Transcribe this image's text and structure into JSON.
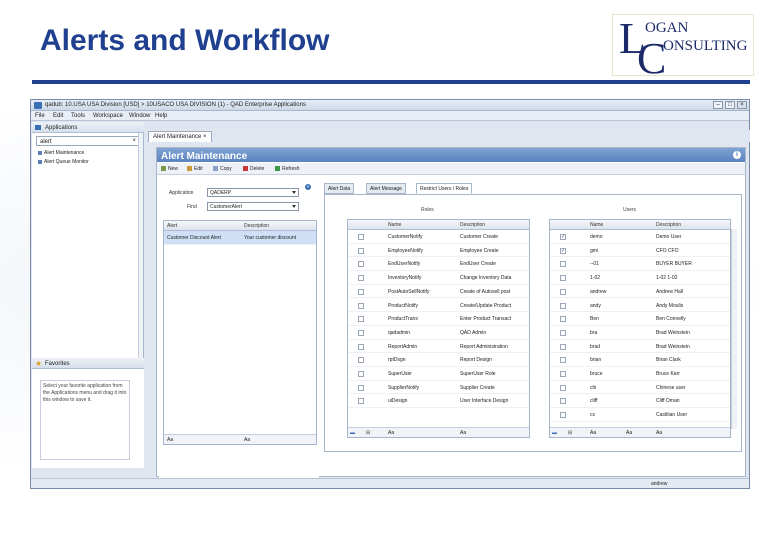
{
  "slide": {
    "title": "Alerts and Workflow"
  },
  "logo": {
    "big1": "L",
    "word1": "OGAN",
    "big2": "C",
    "word2": "ONSULTING"
  },
  "window": {
    "title": "qadub: 10.USA USA Division [USD] > 10USACO USA DIVISION (1) - QAD Enterprise Applications"
  },
  "menu": [
    "File",
    "Edit",
    "Tools",
    "Workspace",
    "Window",
    "Help"
  ],
  "left": {
    "header": "Applications",
    "search_value": "alert",
    "items": [
      "Alert Maintenance",
      "Alert Queue Monitor"
    ],
    "favorites_header": "Favorites",
    "favorites_text": "Select your favorite application from the Applications menu and drag it into this window to save it."
  },
  "tab": {
    "label": "Alert Maintenance"
  },
  "panel": {
    "title": "Alert Maintenance"
  },
  "toolbar": [
    "New",
    "Edit",
    "Copy",
    "Delete",
    "Refresh"
  ],
  "form": {
    "application_label": "Application",
    "application_value": "QADERP",
    "find_label": "Find",
    "find_value": "CustomerAlert",
    "grid_cols": [
      "Alert",
      "Description"
    ],
    "grid_rows": [
      [
        "Customer Discount Alert",
        "Your customer discount"
      ]
    ],
    "footer": [
      "Aa",
      "Aa"
    ]
  },
  "subtabs": [
    "Alert Data",
    "Alert Message",
    "Restrict Users / Roles"
  ],
  "roles": {
    "caption": "Roles",
    "cols": [
      "Name",
      "Description"
    ],
    "rows": [
      [
        "CustomerNotify",
        "Customer Create"
      ],
      [
        "EmployeeNotify",
        "Employee Create"
      ],
      [
        "EndUserNotify",
        "EndUser Create"
      ],
      [
        "InventoryNotify",
        "Change Inventory Data"
      ],
      [
        "PostAutoSellNotify",
        "Create of Autosell post"
      ],
      [
        "ProductNotify",
        "Create/Update Product"
      ],
      [
        "ProductTrans",
        "Enter Product Transact"
      ],
      [
        "qadadmin",
        "QAD Admin"
      ],
      [
        "ReportAdmin",
        "Report Administration"
      ],
      [
        "rptDsgn",
        "Report Design"
      ],
      [
        "SuperUser",
        "SuperUser Role"
      ],
      [
        "SupplierNotify",
        "Supplier Create"
      ],
      [
        "uiDesign",
        "User Interface Design"
      ]
    ],
    "footer": [
      "Aa",
      "Aa"
    ]
  },
  "users": {
    "caption": "Users",
    "cols": [
      "Name",
      "Description"
    ],
    "rows": [
      [
        "demo",
        "Demo User",
        true
      ],
      [
        "gmi",
        "CFO CFO",
        true
      ],
      [
        "--01",
        "BUYER BUYER",
        false
      ],
      [
        "1-02",
        "1-02 1-02",
        false
      ],
      [
        "andrew",
        "Andrew Hall",
        false
      ],
      [
        "andy",
        "Andy Moulis",
        false
      ],
      [
        "Ben",
        "Ben Connelly",
        false
      ],
      [
        "bra",
        "Brad Weinstein",
        false
      ],
      [
        "brad",
        "Brad Weinstein",
        false
      ],
      [
        "brian",
        "Brian Clark",
        false
      ],
      [
        "bruce",
        "Bruce Karr",
        false
      ],
      [
        "chi",
        "Chinese user",
        false
      ],
      [
        "cliff",
        "Cliff Oman",
        false
      ],
      [
        "cs",
        "Castilian User",
        false
      ]
    ],
    "footer": [
      "Aa",
      "Aa",
      "Aa"
    ]
  },
  "status": {
    "user": "andrew"
  },
  "colors": {
    "accent": "#1f3f8f",
    "panel_header": "#5a82bf"
  }
}
